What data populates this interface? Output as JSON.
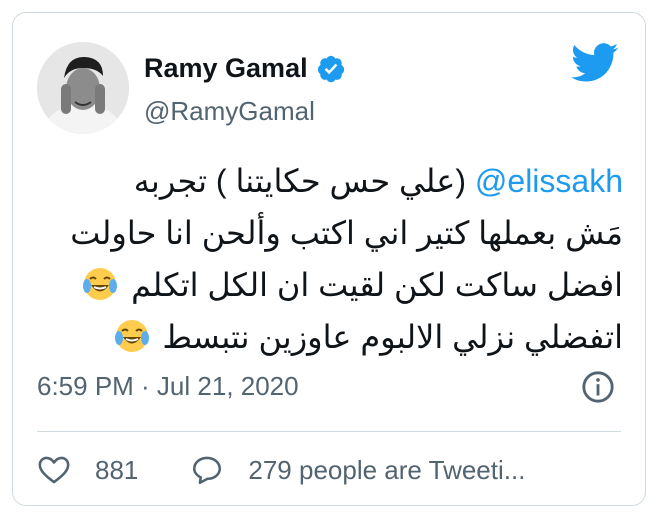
{
  "tweet": {
    "author": {
      "display_name": "Ramy Gamal",
      "handle": "@RamyGamal",
      "verified": true
    },
    "body": {
      "mention": "@elissakh",
      "line1_text": " (علي حس حكايتنا ) تجربه",
      "line2": "مَش بعملها كتير اني اكتب وألحن انا حاولت",
      "line3": "افضل ساكت لكن لقيت ان الكل اتكلم",
      "line4": "اتفضلي نزلي الالبوم عاوزين نتبسط",
      "emoji": "face-with-tears-of-joy"
    },
    "timestamp": "6:59 PM · Jul 21, 2020",
    "likes": "881",
    "conversation": "279 people are Tweeti..."
  },
  "colors": {
    "accent": "#1d9bf0",
    "text_primary": "#0f1419",
    "text_secondary": "#536471",
    "border": "#cfd9de"
  },
  "icons": [
    "twitter-bird-icon",
    "verified-badge-icon",
    "info-icon",
    "heart-icon",
    "reply-icon"
  ]
}
